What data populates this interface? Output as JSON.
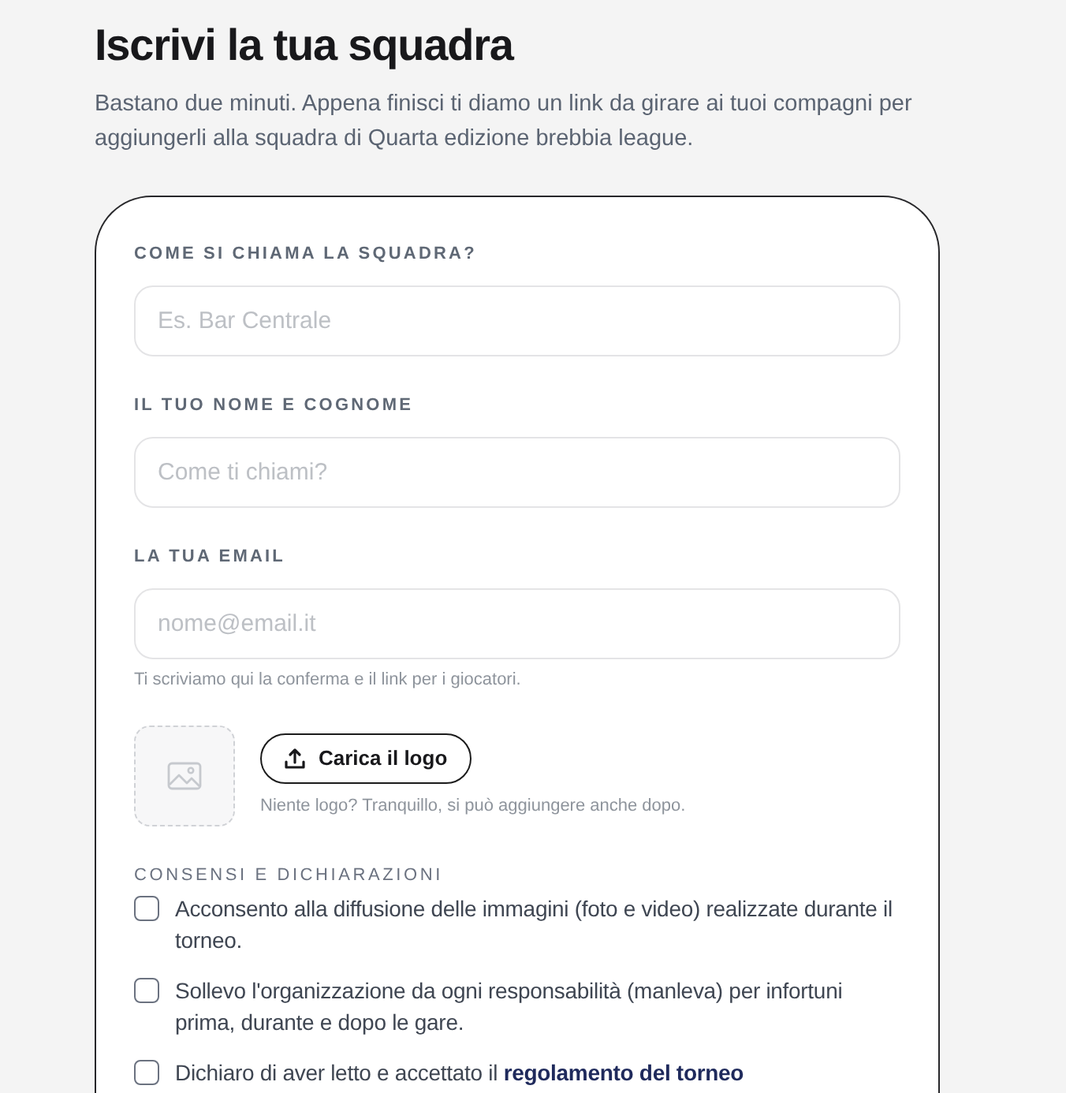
{
  "header": {
    "title": "Iscrivi la tua squadra",
    "subtitle": "Bastano due minuti. Appena finisci ti diamo un link da girare ai tuoi compagni per aggiungerli alla squadra di Quarta edizione brebbia league."
  },
  "form": {
    "fields": [
      {
        "label": "COME SI CHIAMA LA SQUADRA?",
        "placeholder": "Es. Bar Centrale"
      },
      {
        "label": "IL TUO NOME E COGNOME",
        "placeholder": "Come ti chiami?"
      },
      {
        "label": "LA TUA EMAIL",
        "placeholder": "nome@email.it",
        "hint": "Ti scriviamo qui la conferma e il link per i giocatori."
      }
    ],
    "logo": {
      "button": "Carica il logo",
      "hint": "Niente logo? Tranquillo, si può aggiungere anche dopo."
    },
    "consents": {
      "title": "CONSENSI E DICHIARAZIONI",
      "items": [
        {
          "text": "Acconsento alla diffusione delle immagini (foto e video) realizzate durante il torneo.",
          "checked": false
        },
        {
          "text": "Sollevo l'organizzazione da ogni responsabilità (manleva) per infortuni prima, durante e dopo le gare.",
          "checked": false
        },
        {
          "text": "Dichiaro di aver letto e accettato il",
          "link": "regolamento del torneo",
          "checked": false
        }
      ]
    }
  }
}
